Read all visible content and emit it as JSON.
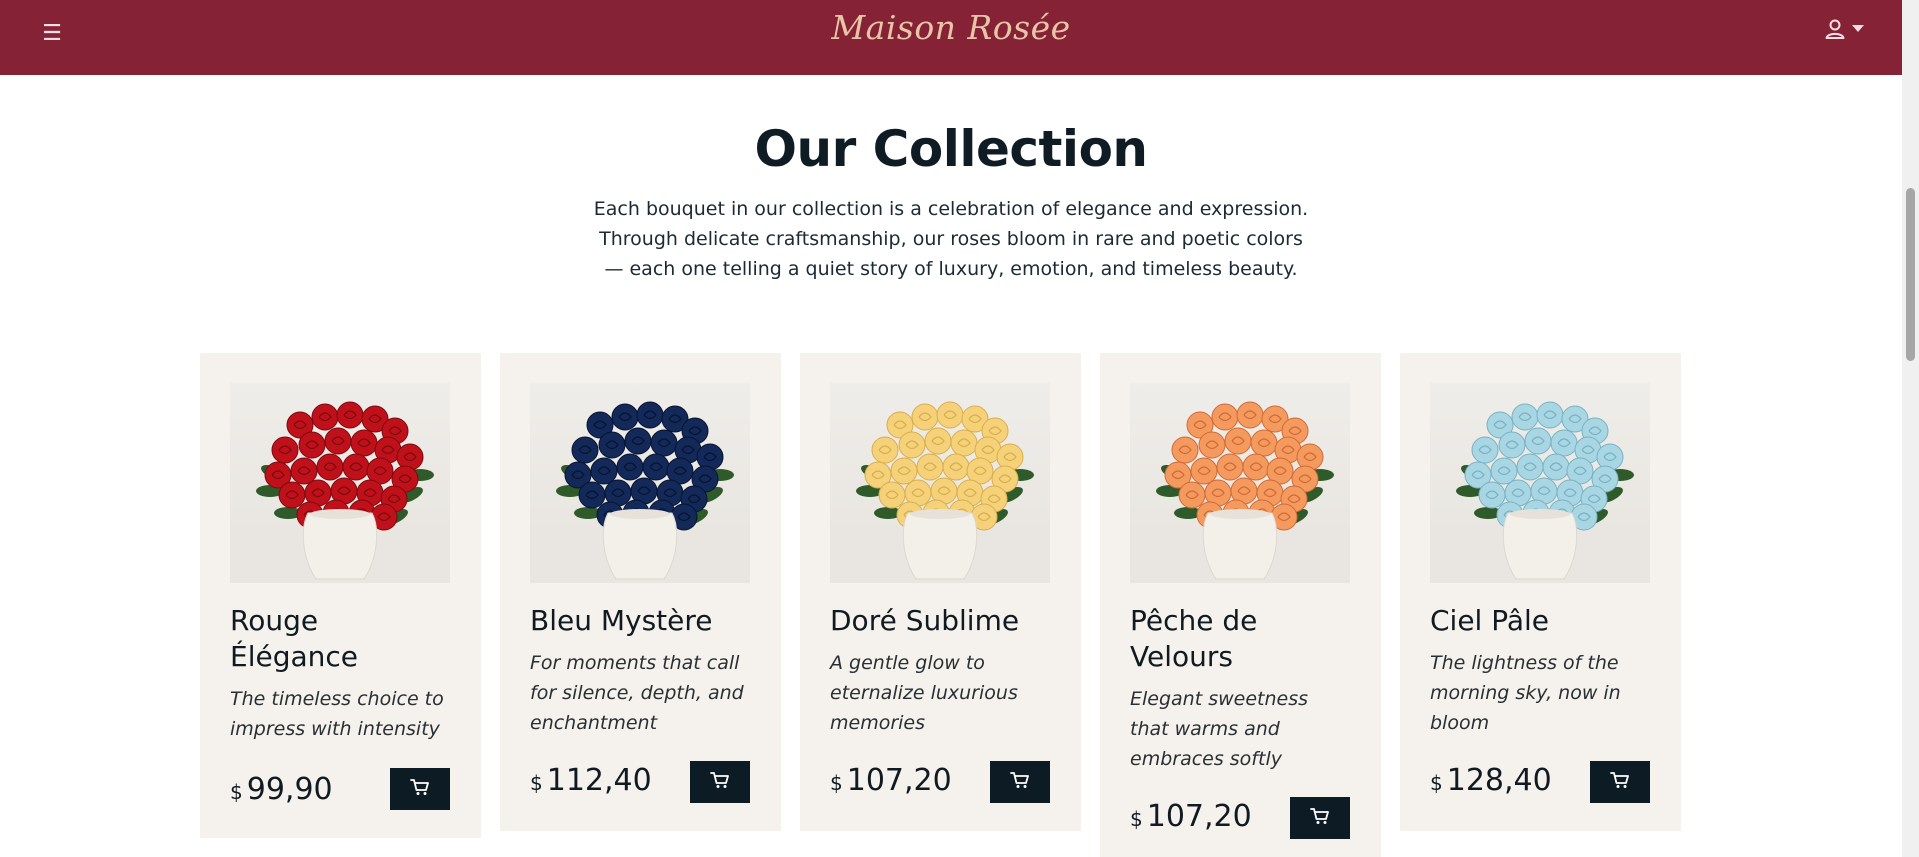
{
  "header": {
    "menu_icon": "hamburger-menu-icon",
    "brand": "Maison Rosée",
    "user_icon": "user-icon",
    "dropdown_icon": "caret-down-icon",
    "background_color": "#862236",
    "brand_color": "#e9c5a8"
  },
  "main": {
    "title": "Our Collection",
    "intro_lines": [
      "Each bouquet in our collection is a celebration of elegance and expression.",
      "Through delicate craftsmanship, our roses bloom in rare and poetic colors",
      "— each one telling a quiet story of luxury, emotion, and timeless beauty."
    ]
  },
  "products": [
    {
      "name_lines": [
        "Rouge",
        "Élégance"
      ],
      "desc_lines": [
        "The timeless choice to",
        "impress with intensity"
      ],
      "currency": "$",
      "price": "99,90",
      "rose_color": "#c0111a",
      "rose_dark": "#7a0a10"
    },
    {
      "name_lines": [
        "Bleu Mystère"
      ],
      "desc_lines": [
        "For moments that call",
        "for silence, depth, and",
        "enchantment"
      ],
      "currency": "$",
      "price": "112,40",
      "rose_color": "#13295a",
      "rose_dark": "#08142e"
    },
    {
      "name_lines": [
        "Doré Sublime"
      ],
      "desc_lines": [
        "A gentle glow to",
        "eternalize luxurious",
        "memories"
      ],
      "currency": "$",
      "price": "107,20",
      "rose_color": "#f5d27a",
      "rose_dark": "#d9ad4c"
    },
    {
      "name_lines": [
        "Pêche de",
        "Velours"
      ],
      "desc_lines": [
        "Elegant sweetness",
        "that warms and",
        "embraces softly"
      ],
      "currency": "$",
      "price": "107,20",
      "rose_color": "#f59a5e",
      "rose_dark": "#d06a35"
    },
    {
      "name_lines": [
        "Ciel Pâle"
      ],
      "desc_lines": [
        "The lightness of the",
        "morning sky, now in",
        "bloom"
      ],
      "currency": "$",
      "price": "128,40",
      "rose_color": "#a9d6e3",
      "rose_dark": "#78b2c4"
    }
  ],
  "cart_icon": "shopping-cart-icon",
  "accent_color": "#0d1c24"
}
